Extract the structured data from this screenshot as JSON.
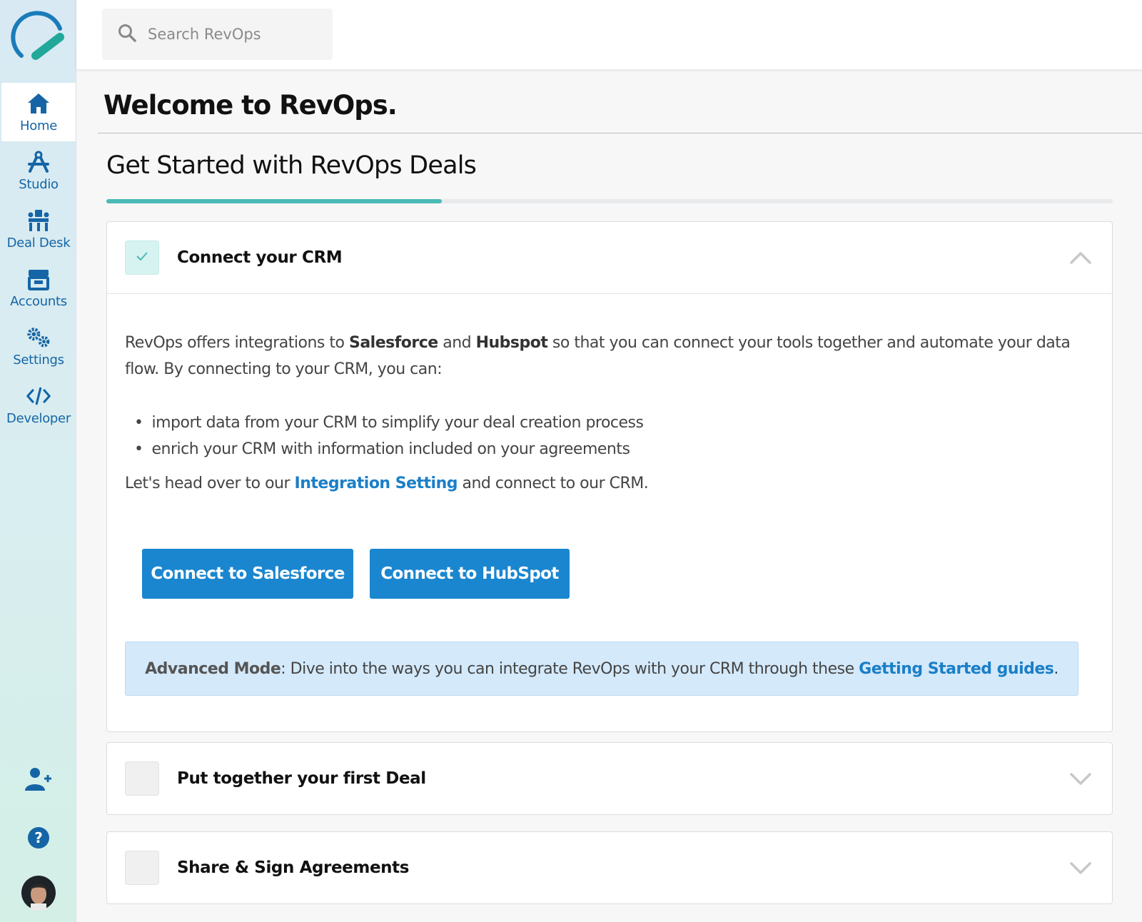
{
  "app": {
    "name": "RevOps",
    "accent": "#1a86cf",
    "teal": "#4bb9b5"
  },
  "sidebar": {
    "logo_icon": "revops-logo-icon",
    "items": [
      {
        "label": "Home",
        "icon": "home-icon",
        "active": true
      },
      {
        "label": "Studio",
        "icon": "studio-icon",
        "active": false
      },
      {
        "label": "Deal Desk",
        "icon": "deal-desk-icon",
        "active": false
      },
      {
        "label": "Accounts",
        "icon": "accounts-icon",
        "active": false
      },
      {
        "label": "Settings",
        "icon": "settings-icon",
        "active": false
      },
      {
        "label": "Developer",
        "icon": "developer-icon",
        "active": false
      }
    ],
    "bottom": [
      "add-user-icon",
      "help-icon",
      "avatar"
    ]
  },
  "search": {
    "placeholder": "Search RevOps",
    "value": ""
  },
  "page": {
    "title": "Welcome to RevOps.",
    "section_title": "Get Started with RevOps Deals",
    "progress_fraction": 0.333
  },
  "cards": [
    {
      "title": "Connect your CRM",
      "checked": true,
      "expanded": true,
      "intro_pre": "RevOps offers integrations to ",
      "intro_b1": "Salesforce",
      "intro_mid": " and ",
      "intro_b2": "Hubspot",
      "intro_post": " so that you can connect your tools together and automate your data flow. By connecting to your CRM, you can:",
      "bullets": [
        "import data from your CRM to simplify your deal creation process",
        "enrich your CRM with information included on your agreements"
      ],
      "cta_pre": "Let's head over to our ",
      "cta_link": "Integration Setting",
      "cta_post": " and connect to our CRM.",
      "buttons": [
        "Connect to Salesforce",
        "Connect to HubSpot"
      ],
      "callout_b": "Advanced Mode",
      "callout_text": ": Dive into the ways you can integrate RevOps with your CRM through these ",
      "callout_link": "Getting Started guides",
      "callout_end": "."
    },
    {
      "title": "Put together your first Deal",
      "checked": false,
      "expanded": false
    },
    {
      "title": "Share & Sign Agreements",
      "checked": false,
      "expanded": false
    }
  ]
}
